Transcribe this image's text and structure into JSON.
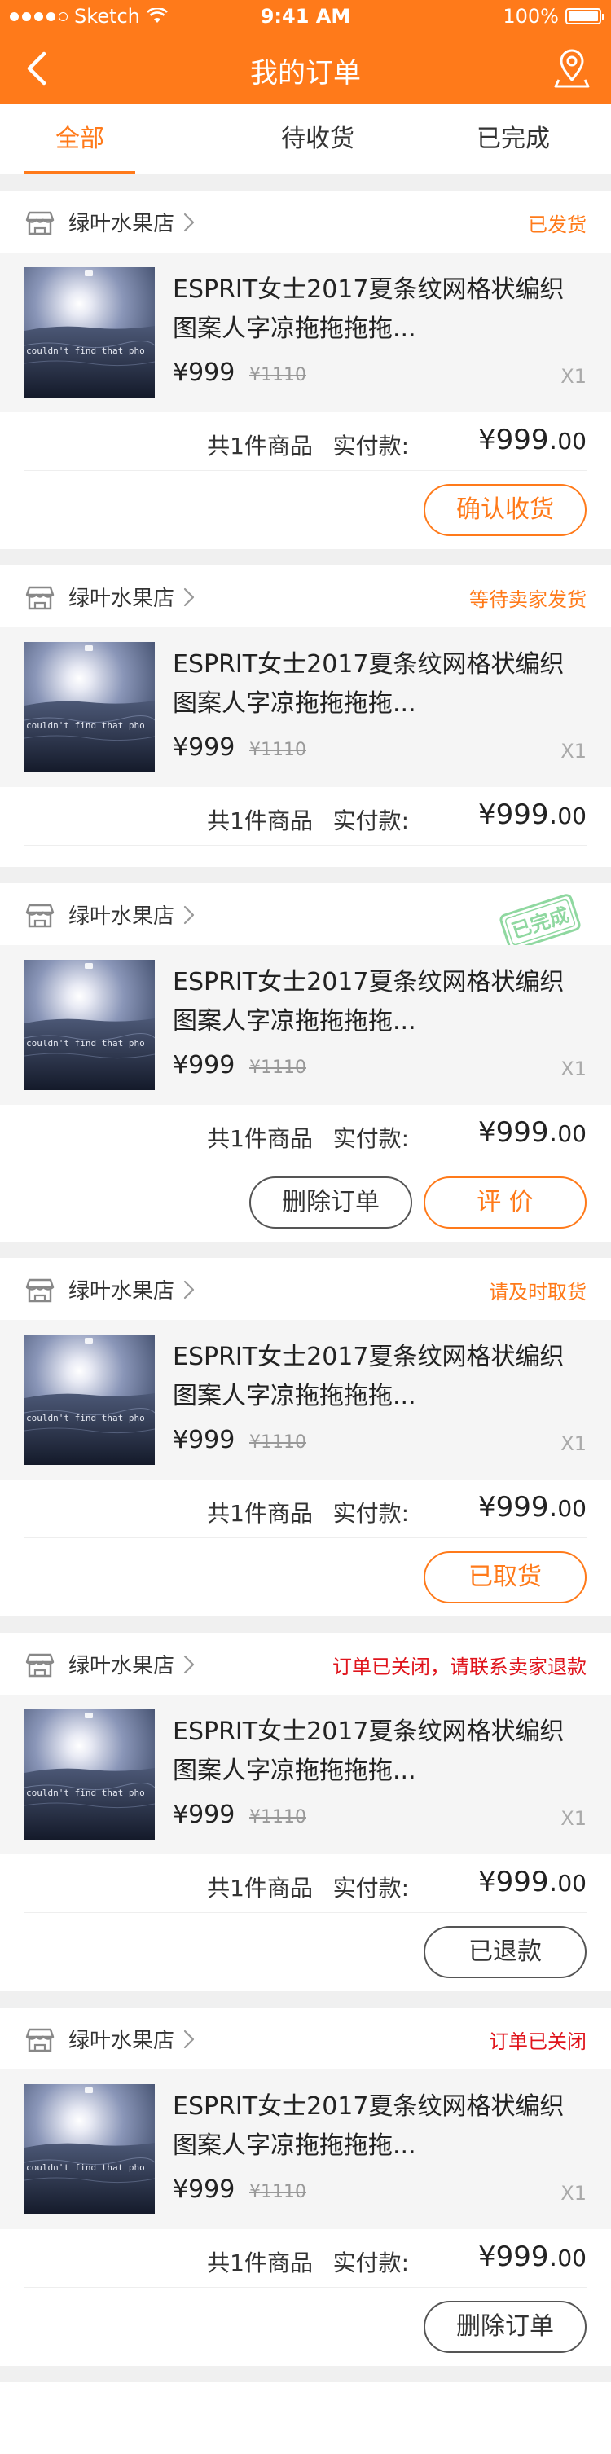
{
  "status_bar": {
    "carrier": "Sketch",
    "time": "9:41 AM",
    "battery": "100%"
  },
  "navbar": {
    "title": "我的订单",
    "back_icon": "chevron-left-icon",
    "right_icon": "location-pin-icon"
  },
  "tabs": [
    {
      "label": "全部",
      "active": true
    },
    {
      "label": "待收货",
      "active": false
    },
    {
      "label": "已完成",
      "active": false
    }
  ],
  "colors": {
    "accent": "#ff7a1a",
    "alert": "#e0141c",
    "background": "#f0f0f0"
  },
  "orders": [
    {
      "shop": "绿叶水果店",
      "status": "已发货",
      "status_color": "orange",
      "image_text": "couldn't find that pho",
      "title": "ESPRIT女士2017夏条纹网格状编织图案人字凉拖拖拖拖...",
      "price": "¥999",
      "old_price": "¥1110",
      "qty": "X1",
      "count_text": "共1件商品",
      "paid_label": "实付款:",
      "amount_int": "¥999.",
      "amount_dec": "00",
      "buttons": [
        {
          "label": "确认收货",
          "style": "orange"
        }
      ]
    },
    {
      "shop": "绿叶水果店",
      "status": "等待卖家发货",
      "status_color": "orange",
      "image_text": "couldn't find that pho",
      "title": "ESPRIT女士2017夏条纹网格状编织图案人字凉拖拖拖拖...",
      "price": "¥999",
      "old_price": "¥1110",
      "qty": "X1",
      "count_text": "共1件商品",
      "paid_label": "实付款:",
      "amount_int": "¥999.",
      "amount_dec": "00",
      "buttons": []
    },
    {
      "shop": "绿叶水果店",
      "status": "已完成",
      "status_color": "stamp",
      "image_text": "couldn't find that pho",
      "title": "ESPRIT女士2017夏条纹网格状编织图案人字凉拖拖拖拖...",
      "price": "¥999",
      "old_price": "¥1110",
      "qty": "X1",
      "count_text": "共1件商品",
      "paid_label": "实付款:",
      "amount_int": "¥999.",
      "amount_dec": "00",
      "buttons": [
        {
          "label": "删除订单",
          "style": "gray"
        },
        {
          "label": "评 价",
          "style": "orange"
        }
      ]
    },
    {
      "shop": "绿叶水果店",
      "status": "请及时取货",
      "status_color": "orange",
      "image_text": "couldn't find that pho",
      "title": "ESPRIT女士2017夏条纹网格状编织图案人字凉拖拖拖拖...",
      "price": "¥999",
      "old_price": "¥1110",
      "qty": "X1",
      "count_text": "共1件商品",
      "paid_label": "实付款:",
      "amount_int": "¥999.",
      "amount_dec": "00",
      "buttons": [
        {
          "label": "已取货",
          "style": "orange"
        }
      ]
    },
    {
      "shop": "绿叶水果店",
      "status": "订单已关闭，请联系卖家退款",
      "status_color": "red",
      "image_text": "couldn't find that pho",
      "title": "ESPRIT女士2017夏条纹网格状编织图案人字凉拖拖拖拖...",
      "price": "¥999",
      "old_price": "¥1110",
      "qty": "X1",
      "count_text": "共1件商品",
      "paid_label": "实付款:",
      "amount_int": "¥999.",
      "amount_dec": "00",
      "buttons": [
        {
          "label": "已退款",
          "style": "gray"
        }
      ]
    },
    {
      "shop": "绿叶水果店",
      "status": "订单已关闭",
      "status_color": "red",
      "image_text": "couldn't find that pho",
      "title": "ESPRIT女士2017夏条纹网格状编织图案人字凉拖拖拖拖...",
      "price": "¥999",
      "old_price": "¥1110",
      "qty": "X1",
      "count_text": "共1件商品",
      "paid_label": "实付款:",
      "amount_int": "¥999.",
      "amount_dec": "00",
      "buttons": [
        {
          "label": "删除订单",
          "style": "gray"
        }
      ]
    }
  ]
}
